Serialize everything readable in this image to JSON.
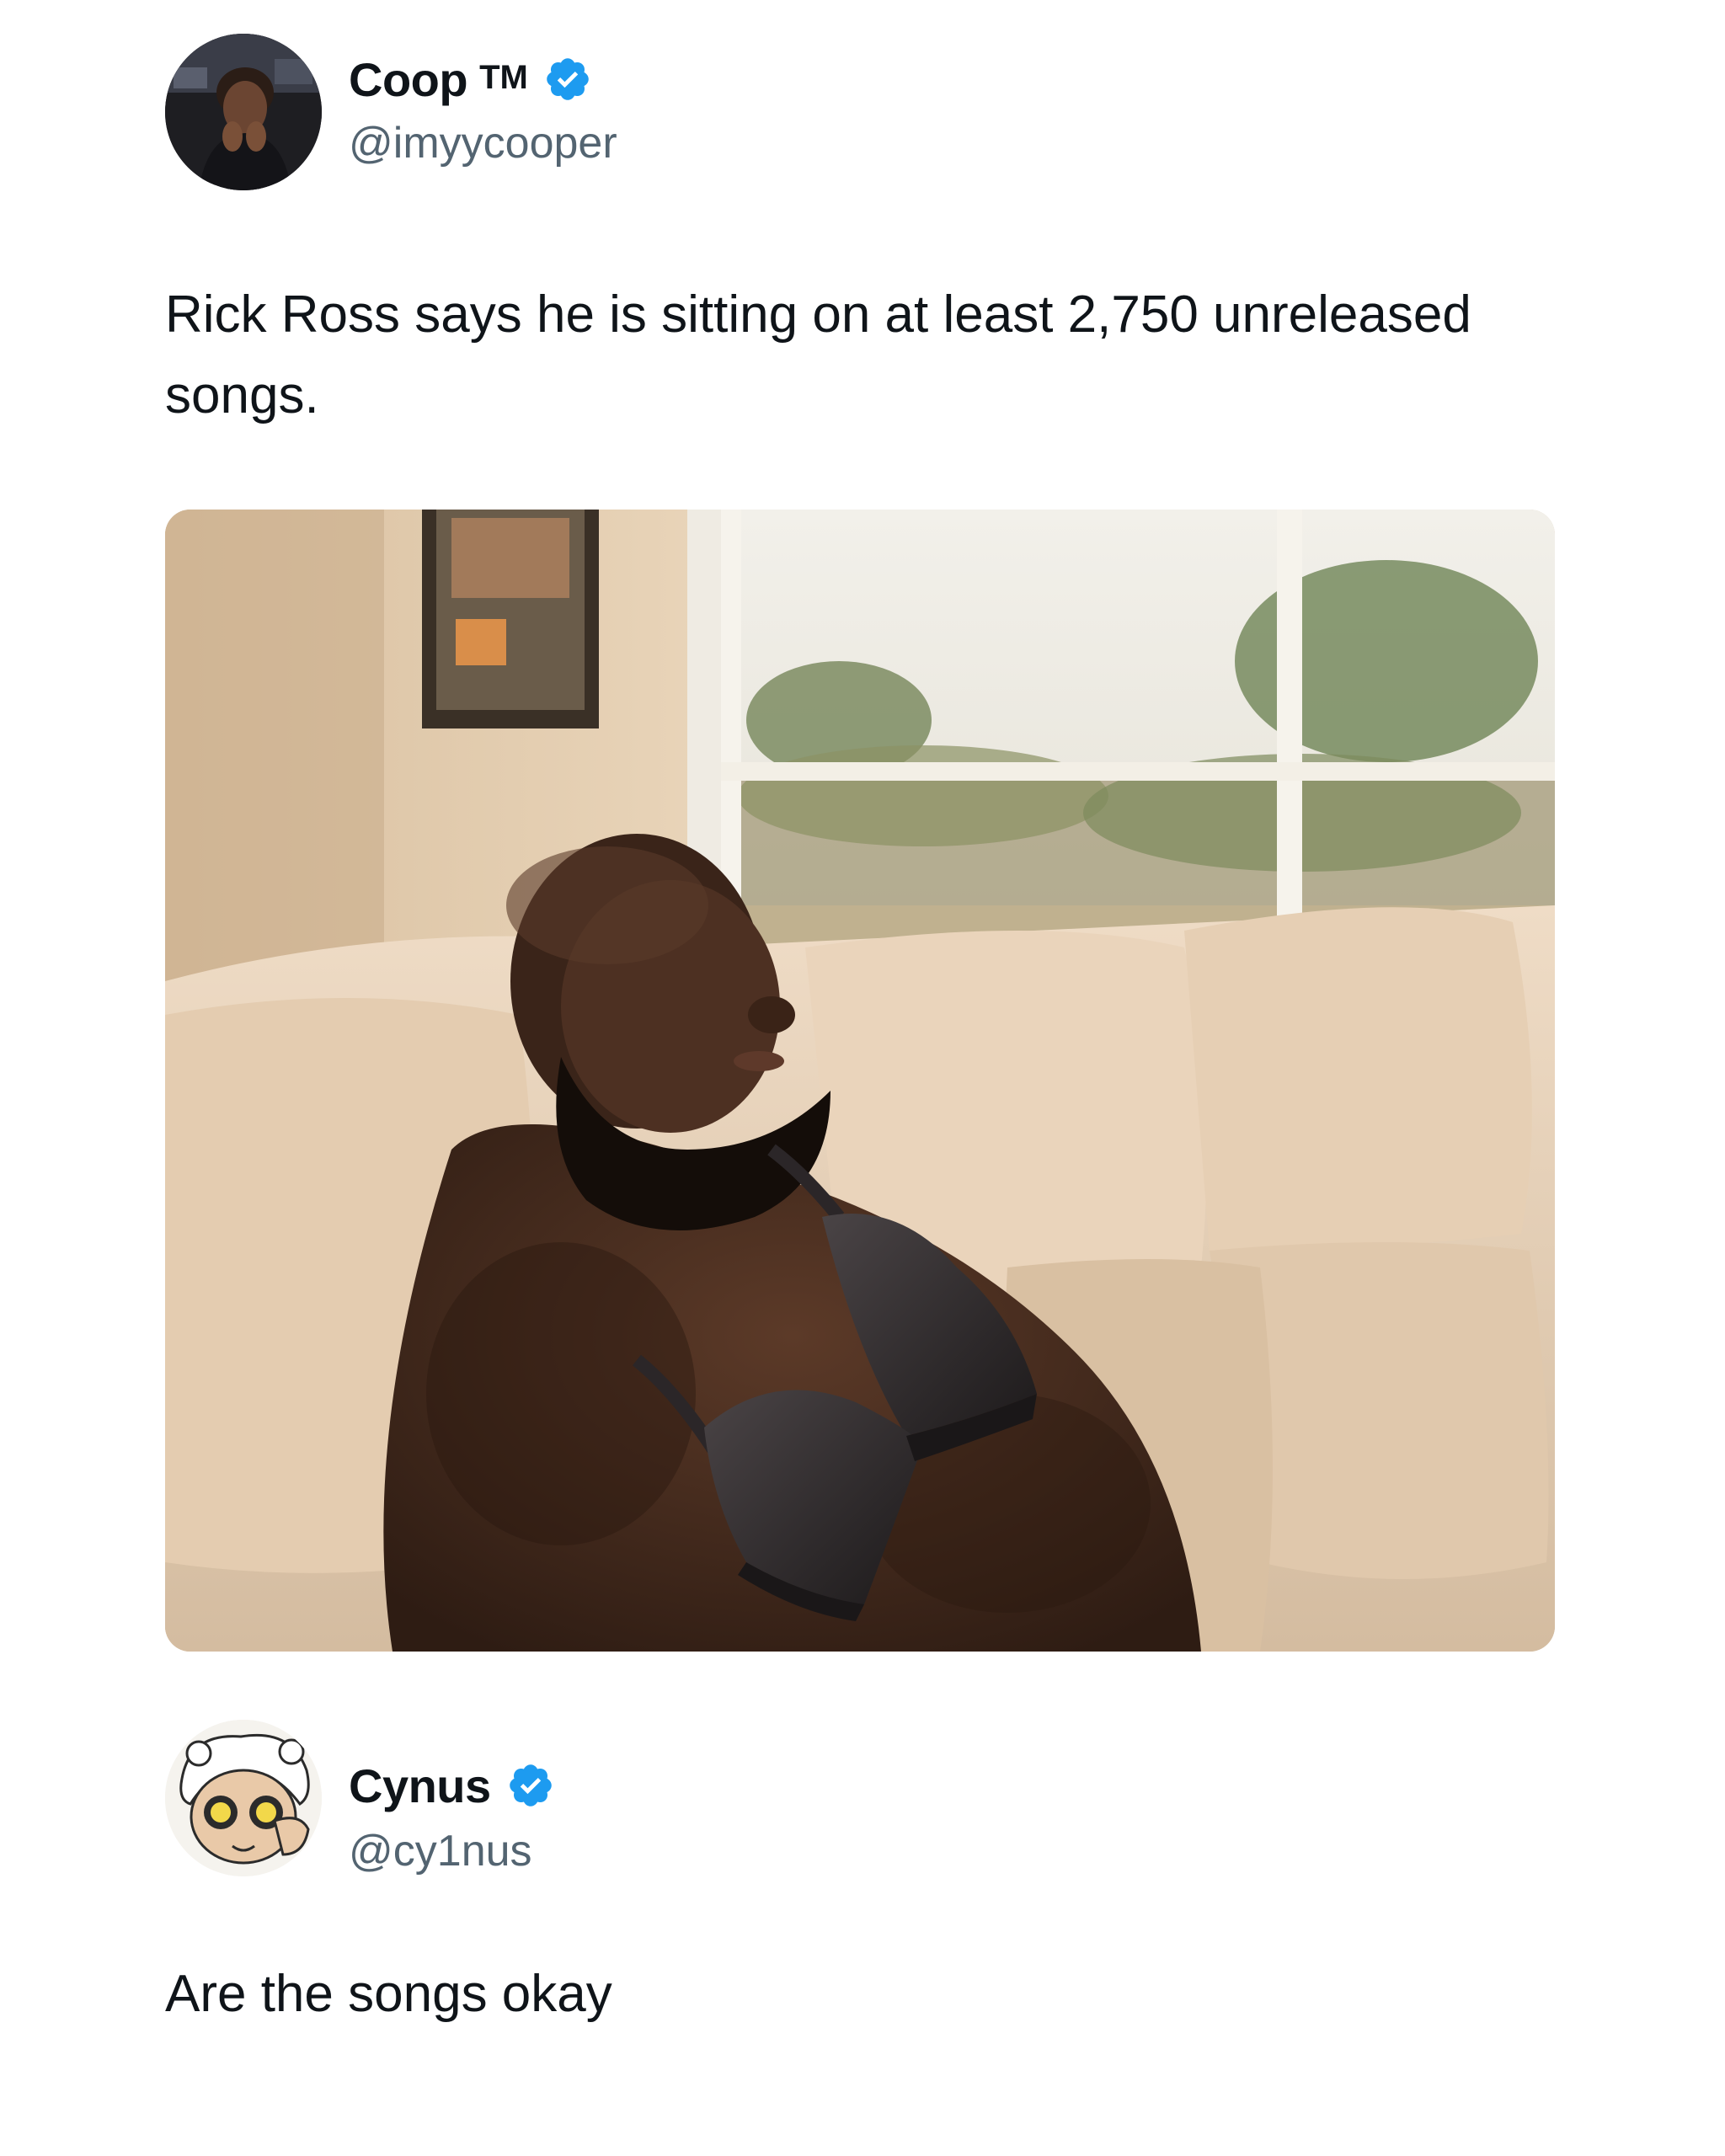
{
  "original_post": {
    "author": {
      "display_name": "Coop",
      "name_suffix": "TM",
      "handle": "@imyycooper",
      "verified": true,
      "avatar_icon": "profile-photo"
    },
    "text": "Rick Ross says he is sitting on at least 2,750 unreleased songs.",
    "media": {
      "type": "photo",
      "icon": "photo-shirtless-man-on-couch-with-bra"
    }
  },
  "reply_post": {
    "author": {
      "display_name": "Cynus",
      "handle": "@cy1nus",
      "verified": true,
      "avatar_icon": "anime-character-avatar"
    },
    "text": "Are the songs okay"
  },
  "colors": {
    "verified_badge": "#1d9bf0",
    "handle_text": "#536471",
    "body_text": "#0f1419",
    "background": "#ffffff"
  }
}
